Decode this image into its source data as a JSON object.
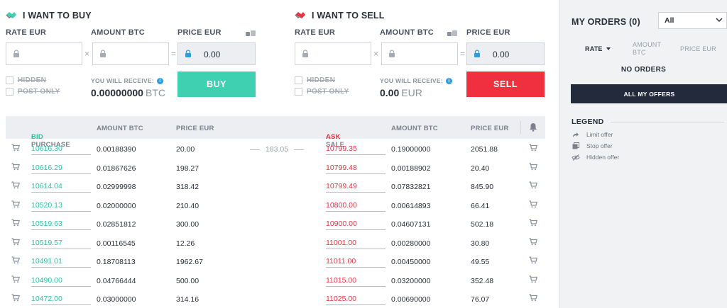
{
  "buy_form": {
    "title": "I WANT TO BUY",
    "rate_label": "RATE EUR",
    "amount_label": "AMOUNT BTC",
    "price_label": "PRICE EUR",
    "price_value": "0.00",
    "hidden_label": "HIDDEN",
    "post_only_label": "POST ONLY",
    "receive_label": "YOU WILL RECEIVE:",
    "receive_value": "0.00000000",
    "receive_currency": "BTC",
    "button_label": "BUY",
    "multiply_sign": "×",
    "equals_sign": "="
  },
  "sell_form": {
    "title": "I WANT TO SELL",
    "rate_label": "RATE EUR",
    "amount_label": "AMOUNT BTC",
    "price_label": "PRICE EUR",
    "price_value": "0.00",
    "hidden_label": "HIDDEN",
    "post_only_label": "POST ONLY",
    "receive_label": "YOU WILL RECEIVE:",
    "receive_value": "0.00",
    "receive_currency": "EUR",
    "button_label": "SELL",
    "multiply_sign": "×",
    "equals_sign": "="
  },
  "order_book": {
    "headers": {
      "bid": "BID",
      "bid_rest": " - PURCHASE",
      "amount_bid": "AMOUNT BTC",
      "price_bid": "PRICE EUR",
      "ask": "ASK",
      "ask_rest": "- SALE",
      "amount_ask": "AMOUNT BTC",
      "price_ask": "PRICE EUR"
    },
    "spread": "183.05",
    "rows": [
      {
        "bid": "10616.30",
        "bid_amount": "0.00188390",
        "bid_price": "20.00",
        "ask": "10799.35",
        "ask_amount": "0.19000000",
        "ask_price": "2051.88"
      },
      {
        "bid": "10616.29",
        "bid_amount": "0.01867626",
        "bid_price": "198.27",
        "ask": "10799.48",
        "ask_amount": "0.00188902",
        "ask_price": "20.40"
      },
      {
        "bid": "10614.04",
        "bid_amount": "0.02999998",
        "bid_price": "318.42",
        "ask": "10799.49",
        "ask_amount": "0.07832821",
        "ask_price": "845.90"
      },
      {
        "bid": "10520.13",
        "bid_amount": "0.02000000",
        "bid_price": "210.40",
        "ask": "10800.00",
        "ask_amount": "0.00614893",
        "ask_price": "66.41"
      },
      {
        "bid": "10519.63",
        "bid_amount": "0.02851812",
        "bid_price": "300.00",
        "ask": "10900.00",
        "ask_amount": "0.04607131",
        "ask_price": "502.18"
      },
      {
        "bid": "10519.57",
        "bid_amount": "0.00116545",
        "bid_price": "12.26",
        "ask": "11001.00",
        "ask_amount": "0.00280000",
        "ask_price": "30.80"
      },
      {
        "bid": "10491.01",
        "bid_amount": "0.18708113",
        "bid_price": "1962.67",
        "ask": "11011.00",
        "ask_amount": "0.00450000",
        "ask_price": "49.55"
      },
      {
        "bid": "10490.00",
        "bid_amount": "0.04766444",
        "bid_price": "500.00",
        "ask": "11015.00",
        "ask_amount": "0.03200000",
        "ask_price": "352.48"
      },
      {
        "bid": "10472.00",
        "bid_amount": "0.03000000",
        "bid_price": "314.16",
        "ask": "11025.00",
        "ask_amount": "0.00690000",
        "ask_price": "76.07"
      }
    ]
  },
  "my_orders": {
    "title": "MY ORDERS (0)",
    "filter_value": "All",
    "headers": {
      "rate": "RATE",
      "amount_line1": "AMOUNT",
      "amount_line2": "BTC",
      "price": "PRICE EUR"
    },
    "empty_text": "NO ORDERS",
    "all_offers_button": "ALL MY OFFERS"
  },
  "legend": {
    "title": "LEGEND",
    "items": [
      {
        "icon": "share-arrow-icon",
        "label": "Limit offer"
      },
      {
        "icon": "stop-layers-icon",
        "label": "Stop offer"
      },
      {
        "icon": "eye-off-icon",
        "label": "Hidden offer"
      }
    ]
  },
  "colors": {
    "bid_green": "#2fc3a5",
    "buy_button": "#3ed0b1",
    "sell_red": "#f0303f",
    "dark_button": "#232a3b",
    "info_blue": "#2b9de0"
  }
}
